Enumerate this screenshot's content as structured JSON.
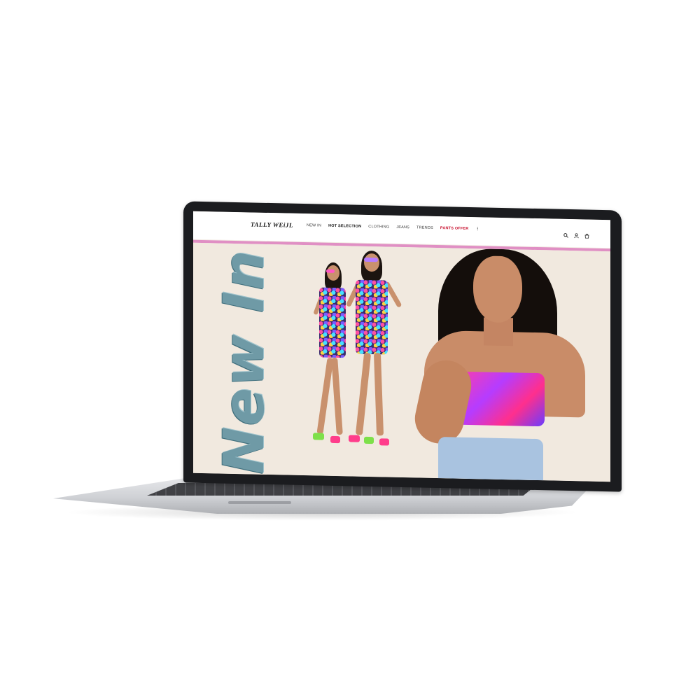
{
  "site": {
    "brand": "TALLY WEiJL",
    "nav": [
      {
        "label": "NEW IN",
        "style": "normal"
      },
      {
        "label": "HOT SELECTION",
        "style": "bold"
      },
      {
        "label": "CLOTHING",
        "style": "normal"
      },
      {
        "label": "JEANS",
        "style": "normal"
      },
      {
        "label": "TRENDS",
        "style": "normal"
      },
      {
        "label": "PANTS OFFER",
        "style": "offer"
      }
    ],
    "more_glyph": "⋮",
    "icons": [
      "search-icon",
      "user-icon",
      "bag-icon"
    ],
    "accent_color": "#e08fc4",
    "offer_color": "#c8102e"
  },
  "hero": {
    "headline": "New In"
  }
}
